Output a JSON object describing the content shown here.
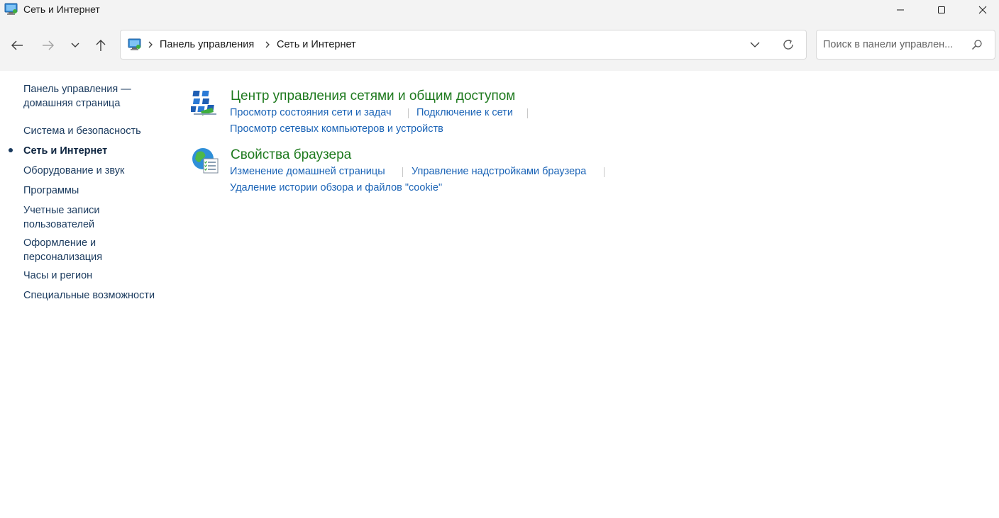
{
  "window": {
    "title": "Сеть и Интернет",
    "minimize_glyph": "—",
    "maximize_glyph": "☐",
    "close_glyph": "✕"
  },
  "breadcrumb": {
    "items": [
      "Панель управления",
      "Сеть и Интернет"
    ]
  },
  "search": {
    "placeholder": "Поиск в панели управлен...",
    "value": ""
  },
  "sidebar": {
    "items": [
      {
        "label": "Панель управления — домашняя страница",
        "active": false
      },
      {
        "label": "Система и безопасность",
        "active": false
      },
      {
        "label": "Сеть и Интернет",
        "active": true
      },
      {
        "label": "Оборудование и звук",
        "active": false
      },
      {
        "label": "Программы",
        "active": false
      },
      {
        "label": "Учетные записи пользователей",
        "active": false
      },
      {
        "label": "Оформление и персонализация",
        "active": false
      },
      {
        "label": "Часы и регион",
        "active": false
      },
      {
        "label": "Специальные возможности",
        "active": false
      }
    ]
  },
  "sections": [
    {
      "title": "Центр управления сетями и общим доступом",
      "icon": "network-center-icon",
      "links": [
        "Просмотр состояния сети и задач",
        "Подключение к сети",
        "Просмотр сетевых компьютеров и устройств"
      ]
    },
    {
      "title": "Свойства браузера",
      "icon": "internet-options-icon",
      "links": [
        "Изменение домашней страницы",
        "Управление надстройками браузера",
        "Удаление истории обзора и файлов \"cookie\""
      ]
    }
  ],
  "colors": {
    "title_green": "#1e7a1e",
    "link_blue": "#1a63b6",
    "nav_text": "#1a3a5e",
    "chrome_bg": "#f3f3f3"
  }
}
